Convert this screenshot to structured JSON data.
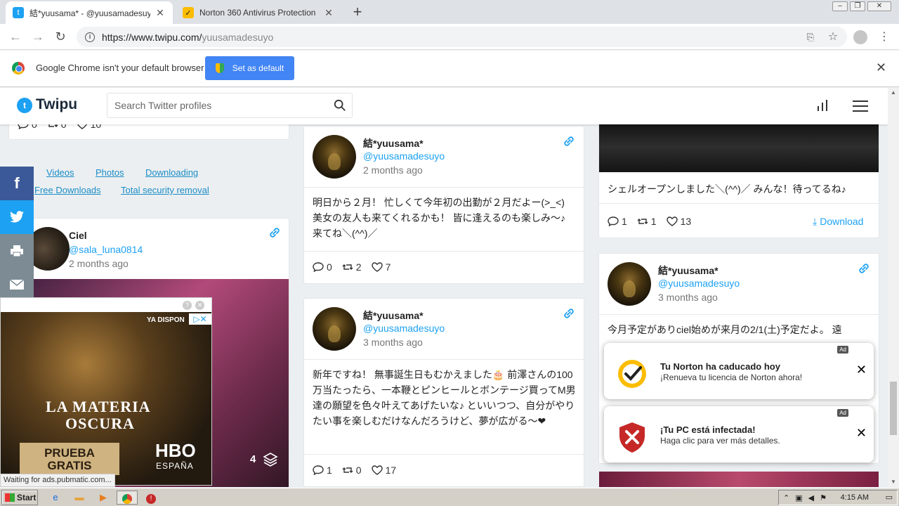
{
  "browser": {
    "tabs": [
      {
        "title": "結*yuusama* - @yuusamadesuyo Tw",
        "active": true
      },
      {
        "title": "Norton 360 Antivirus Protection",
        "active": false
      }
    ],
    "url_domain": "https://www.twipu.com/",
    "url_path": "yuusamadesuyo",
    "infobar_message": "Google Chrome isn't your default browser",
    "infobar_button": "Set as default",
    "status_text": "Waiting for ads.pubmatic.com..."
  },
  "site": {
    "logo": "Twipu",
    "search_placeholder": "Search Twitter profiles"
  },
  "left_column": {
    "top_stats": {
      "replies": "0",
      "retweets": "0",
      "likes": "10"
    },
    "nav_links": [
      "Videos",
      "Photos",
      "Downloading",
      "Free Downloads",
      "Total security removal"
    ],
    "ciel_card": {
      "name": "Ciel",
      "handle": "@sala_luna0814",
      "ago": "2 months ago"
    },
    "ad": {
      "ya_disponible": "YA DISPON",
      "title1": "LA MATERIA",
      "title2": "OSCURA",
      "button_line1": "PRUEBA",
      "button_line2": "GRATIS",
      "brand": "HBO",
      "brand_sub": "ESPAÑA",
      "count": "4"
    }
  },
  "middle_column": {
    "tweets": [
      {
        "name": "結*yuusama*",
        "handle": "@yuusamadesuyo",
        "ago": "2 months ago",
        "text": "明日から２月！ 忙しくて今年初の出勤が２月だよー(>_<) 美女の友人も来てくれるかも！ 皆に逢えるのも楽しみ〜♪ 来てね＼(^^)／",
        "replies": "0",
        "retweets": "2",
        "likes": "7"
      },
      {
        "name": "結*yuusama*",
        "handle": "@yuusamadesuyo",
        "ago": "3 months ago",
        "text": "新年ですね！ 無事誕生日もむかえました🎂 前澤さんの100万当たったら、一本鞭とピンヒールとボンテージ買ってM男達の願望を色々叶えてあげたいな♪ といいつつ、自分がやりたい事を楽しむだけなんだろうけど、夢が広がる〜❤",
        "replies": "1",
        "retweets": "0",
        "likes": "17"
      }
    ]
  },
  "right_column": {
    "first_tweet": {
      "text": "シェルオープンしました＼(^^)／ みんな！待ってるね♪",
      "replies": "1",
      "retweets": "1",
      "likes": "13",
      "download": "Download"
    },
    "second_tweet": {
      "name": "結*yuusama*",
      "handle": "@yuusamadesuyo",
      "ago": "3 months ago",
      "text": "今月予定がありciel始めが来月の2/1(土)予定だよ。 遠"
    }
  },
  "norton_popups": [
    {
      "ad": "Ad",
      "title": "Tu Norton ha caducado hoy",
      "subtitle": "¡Renueva tu licencia de Norton ahora!"
    },
    {
      "ad": "Ad",
      "title": "¡Tu PC está infectada!",
      "subtitle": "Haga clic para ver más detalles."
    }
  ],
  "taskbar": {
    "start": "Start",
    "clock": "4:15 AM"
  },
  "colors": {
    "twitter_blue": "#1da1f2",
    "chrome_blue": "#4285f4"
  }
}
